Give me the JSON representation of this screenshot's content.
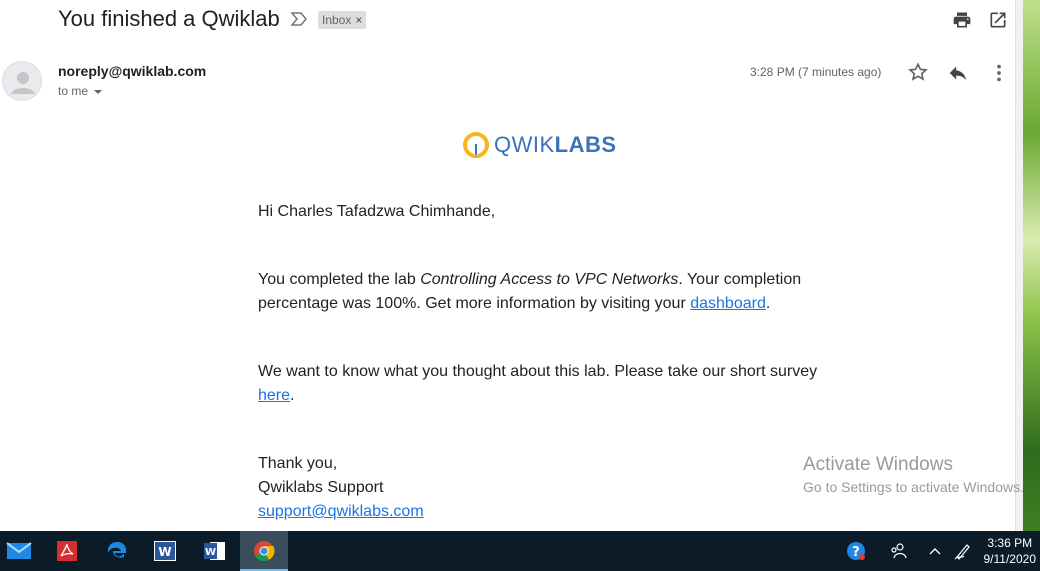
{
  "email": {
    "subject": "You finished a Qwiklab",
    "label": "Inbox",
    "label_remove": "×",
    "sender": "noreply@qwiklab.com",
    "recipient_label": "to me",
    "timestamp": "3:28 PM (7 minutes ago)"
  },
  "logo": {
    "text_light": "QWIK",
    "text_bold": "LABS",
    "brand_color": "#3b73b9",
    "mark_color": "#f9b51b"
  },
  "message": {
    "greeting": "Hi Charles Tafadzwa Chimhande,",
    "p1_before": "You completed the lab ",
    "p1_lab": "Controlling Access to VPC Networks",
    "p1_after": ". Your completion percentage was 100%. Get more information by visiting your ",
    "p1_link": "dashboard",
    "p1_end": ".",
    "p2_before": "We want to know what you thought about this lab. Please take our short survey ",
    "p2_link": "here",
    "p2_end": ".",
    "closing": "Thank you,",
    "signature": "Qwiklabs Support",
    "support_email": "support@qwiklabs.com"
  },
  "watermark": {
    "line1": "Activate Windows",
    "line2": "Go to Settings to activate Windows."
  },
  "taskbar": {
    "apps": [
      "mail-icon",
      "acrobat-icon",
      "edge-icon",
      "word-icon",
      "word-icon",
      "chrome-icon"
    ],
    "active_app": "chrome-icon",
    "tray": [
      "help-icon",
      "people-icon",
      "chevron-up-icon",
      "pen-icon"
    ],
    "time": "3:36 PM",
    "date": "9/11/2020"
  },
  "colors": {
    "link": "#1a73e8",
    "taskbar": "#0b1b27",
    "chip": "#dddddd"
  }
}
